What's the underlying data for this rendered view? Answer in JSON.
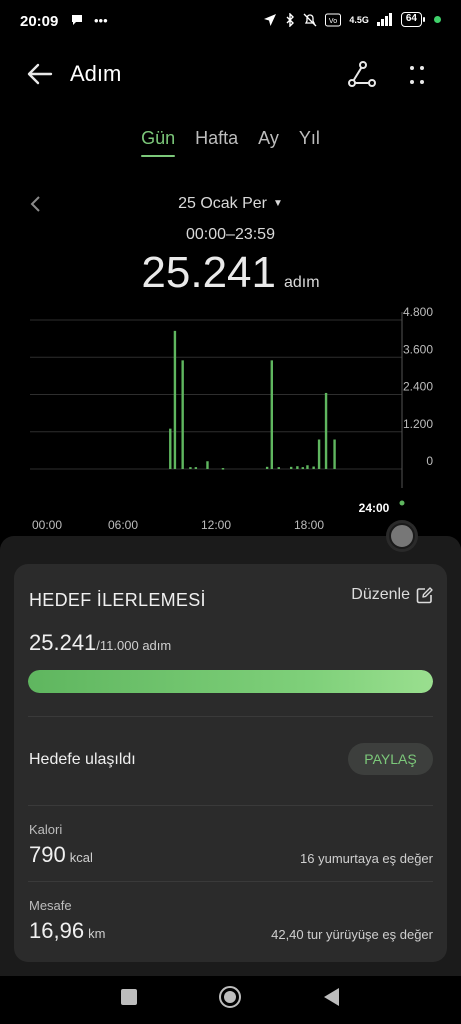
{
  "status": {
    "time": "20:09",
    "network": "4.5G",
    "battery": "64"
  },
  "appbar": {
    "title": "Adım",
    "back_icon": "arrow-left-icon",
    "share_icon": "share-nodes-icon",
    "more_icon": "more-dots-icon"
  },
  "tabs": [
    {
      "label": "Gün",
      "active": true
    },
    {
      "label": "Hafta",
      "active": false
    },
    {
      "label": "Ay",
      "active": false
    },
    {
      "label": "Yıl",
      "active": false
    }
  ],
  "date": {
    "label": "25 Ocak Per",
    "range": "00:00–23:59",
    "steps": "25.241",
    "unit": "adım"
  },
  "chart_data": {
    "type": "bar",
    "y_ticks": [
      "4.800",
      "3.600",
      "2.400",
      "1.200",
      "0"
    ],
    "ylim": [
      0,
      4800
    ],
    "x_ticks": [
      "00:00",
      "06:00",
      "12:00",
      "18:00",
      "24:00"
    ],
    "xlim": [
      0,
      24
    ],
    "bars": [
      {
        "x": 9.05,
        "y": 1300
      },
      {
        "x": 9.35,
        "y": 4450
      },
      {
        "x": 9.85,
        "y": 3500
      },
      {
        "x": 10.35,
        "y": 60
      },
      {
        "x": 10.7,
        "y": 60
      },
      {
        "x": 11.45,
        "y": 250
      },
      {
        "x": 12.45,
        "y": 30
      },
      {
        "x": 15.3,
        "y": 70
      },
      {
        "x": 15.6,
        "y": 3500
      },
      {
        "x": 16.05,
        "y": 60
      },
      {
        "x": 16.85,
        "y": 70
      },
      {
        "x": 17.25,
        "y": 90
      },
      {
        "x": 17.6,
        "y": 60
      },
      {
        "x": 17.9,
        "y": 120
      },
      {
        "x": 18.3,
        "y": 80
      },
      {
        "x": 18.65,
        "y": 950
      },
      {
        "x": 19.1,
        "y": 2450
      },
      {
        "x": 19.65,
        "y": 950
      }
    ],
    "current_label": "24:00",
    "bar_color": "#5fb65f"
  },
  "goal": {
    "title": "HEDEF İLERLEMESİ",
    "edit_label": "Düzenle",
    "current": "25.241",
    "target": "/11.000 adım",
    "progress": 1.0,
    "reached_label": "Hedefe ulaşıldı",
    "share_label": "PAYLAŞ"
  },
  "stats": [
    {
      "label": "Kalori",
      "value": "790",
      "unit": "kcal",
      "equivalent": "16 yumurtaya eş değer"
    },
    {
      "label": "Mesafe",
      "value": "16,96",
      "unit": "km",
      "equivalent": "42,40 tur yürüyüşe eş değer"
    }
  ],
  "colors": {
    "accent": "#7cc87a",
    "background": "#000000",
    "card": "#2b2b2b"
  }
}
